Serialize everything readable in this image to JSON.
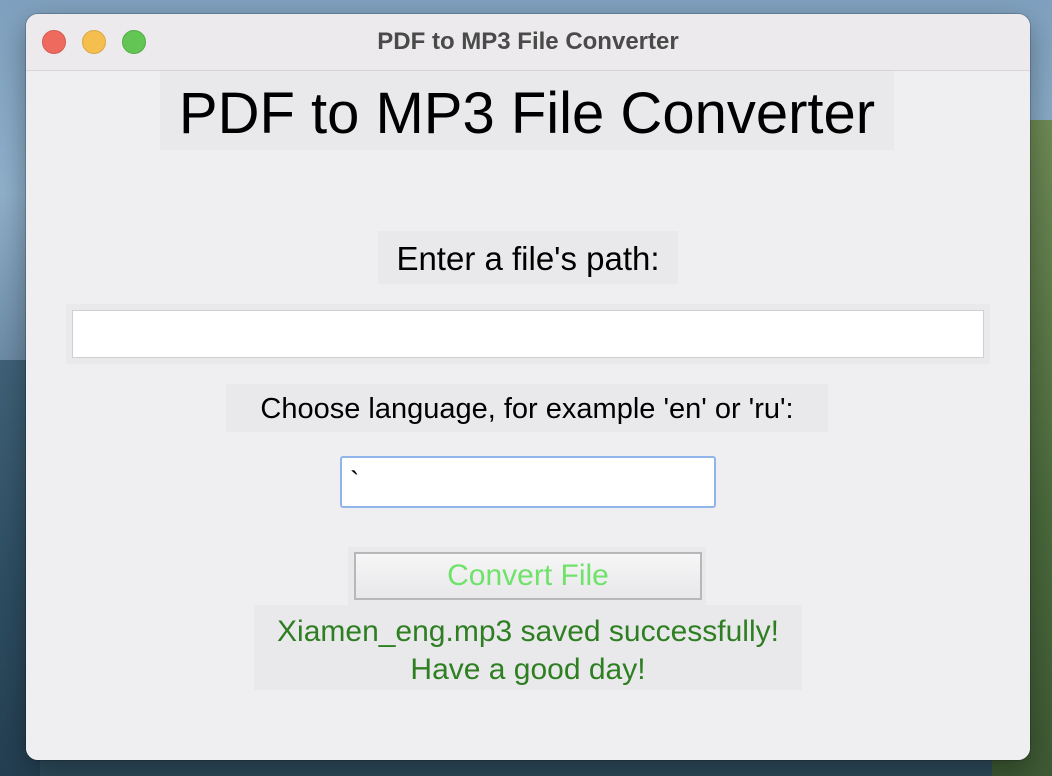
{
  "window": {
    "title": "PDF to MP3 File Converter"
  },
  "app": {
    "heading": "PDF to MP3 File Converter",
    "path_label": "Enter a file's path:",
    "path_value": "",
    "language_label": "Choose language, for example 'en' or 'ru':",
    "language_value": "`",
    "convert_label": "Convert File",
    "status_line1": "Xiamen_eng.mp3 saved successfully!",
    "status_line2": "Have a good day!"
  },
  "colors": {
    "window_bg": "#efeff1",
    "convert_text": "#6fe26a",
    "status_text": "#2e7f22",
    "focus_ring": "#8fb5ea"
  }
}
